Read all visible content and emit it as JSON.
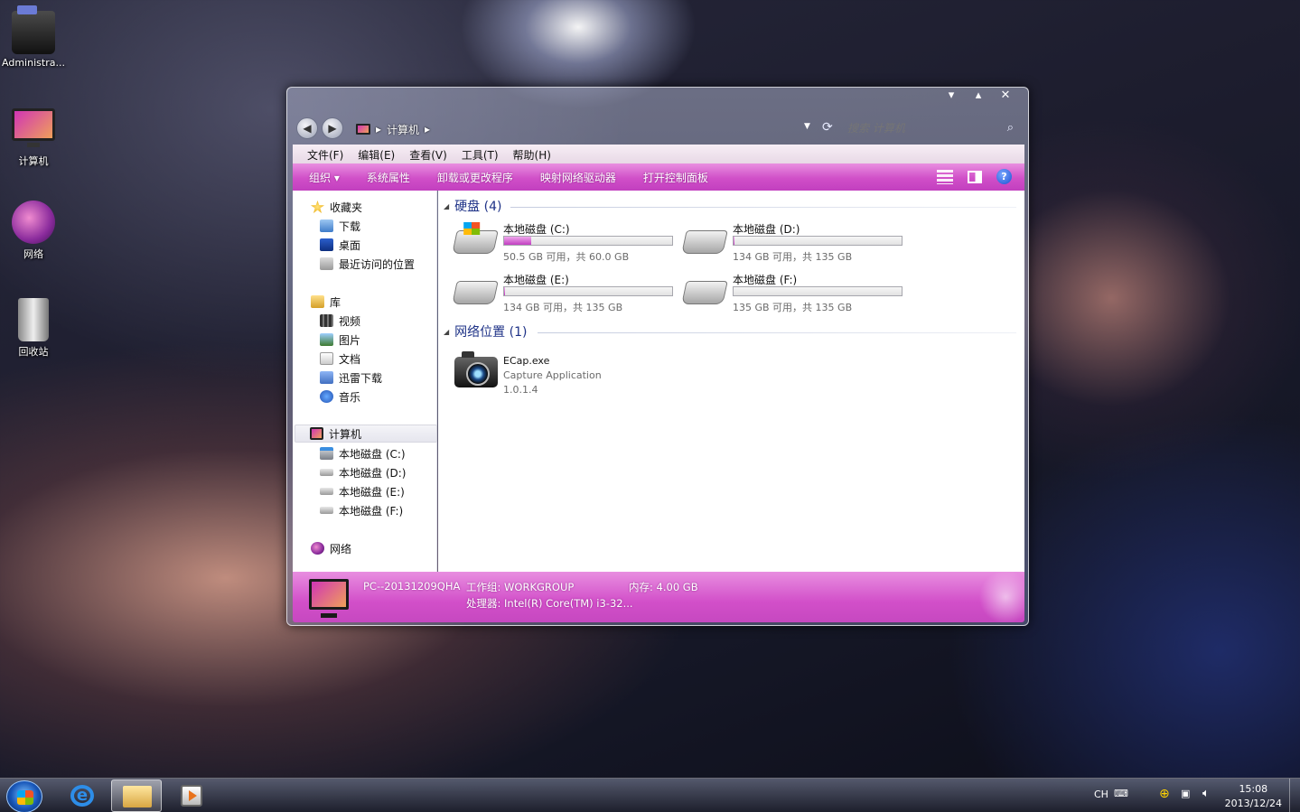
{
  "desktop": {
    "icons": [
      {
        "label": "Administra..."
      },
      {
        "label": "计算机"
      },
      {
        "label": "网络"
      },
      {
        "label": "回收站"
      }
    ]
  },
  "window": {
    "controls": {
      "minimize": "▾",
      "maximize": "▴",
      "close": "✕"
    },
    "address": {
      "back": "◀",
      "forward": "▶",
      "path": [
        "计算机"
      ],
      "separator": "▸"
    },
    "search": {
      "placeholder": "搜索 计算机"
    },
    "menu": [
      "文件(F)",
      "编辑(E)",
      "查看(V)",
      "工具(T)",
      "帮助(H)"
    ],
    "toolbar": {
      "organize": "组织 ▾",
      "items": [
        "系统属性",
        "卸载或更改程序",
        "映射网络驱动器",
        "打开控制面板"
      ],
      "help": "?"
    },
    "nav": {
      "favorites": {
        "label": "收藏夹",
        "items": [
          "下载",
          "桌面",
          "最近访问的位置"
        ]
      },
      "libraries": {
        "label": "库",
        "items": [
          "视频",
          "图片",
          "文档",
          "迅雷下载",
          "音乐"
        ]
      },
      "computer": {
        "label": "计算机",
        "items": [
          "本地磁盘 (C:)",
          "本地磁盘 (D:)",
          "本地磁盘 (E:)",
          "本地磁盘 (F:)"
        ]
      },
      "network": {
        "label": "网络"
      }
    },
    "groups": {
      "drives_title": "硬盘 (4)",
      "network_title": "网络位置 (1)"
    },
    "drives": [
      {
        "name": "本地磁盘 (C:)",
        "free": "50.5 GB 可用，共 60.0 GB",
        "used_fraction": 0.16
      },
      {
        "name": "本地磁盘 (D:)",
        "free": "134 GB 可用，共 135 GB",
        "used_fraction": 0.007
      },
      {
        "name": "本地磁盘 (E:)",
        "free": "134 GB 可用，共 135 GB",
        "used_fraction": 0.007
      },
      {
        "name": "本地磁盘 (F:)",
        "free": "135 GB 可用，共 135 GB",
        "used_fraction": 0.0
      }
    ],
    "network_item": {
      "name": "ECap.exe",
      "description": "Capture Application",
      "version": "1.0.1.4"
    },
    "details": {
      "pc_name": "PC--20131209QHA",
      "workgroup": "工作组: WORKGROUP",
      "memory": "内存: 4.00 GB",
      "processor": "处理器: Intel(R) Core(TM) i3-32..."
    }
  },
  "taskbar": {
    "tray": {
      "lang": "CH"
    },
    "clock": {
      "time": "15:08",
      "date": "2013/12/24"
    }
  },
  "colors": {
    "accent": "#d04fc8",
    "group_title": "#1e3287"
  }
}
